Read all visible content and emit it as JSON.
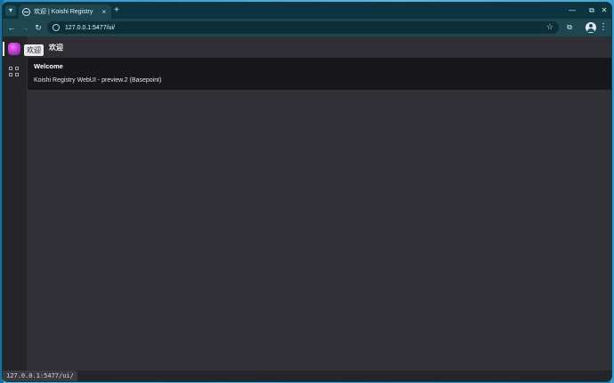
{
  "browser": {
    "tab": {
      "title": "欢迎 | Koishi Registry",
      "close": "×"
    },
    "new_tab": "+",
    "window_controls": {
      "minimize": "—",
      "maximize": "⧉",
      "close": "✕"
    },
    "nav": {
      "back": "←",
      "forward": "→",
      "reload": "↻"
    },
    "address": {
      "url": "127.0.0.1:5477/ui/"
    },
    "toolbar_icons": [
      "bookmark-star-icon",
      "extensions-icon",
      "profile-icon",
      "menu-icon"
    ],
    "menu_glyph": "⋮",
    "extensions_glyph": "⧉",
    "star_glyph": "☆"
  },
  "app": {
    "activity_bar": {
      "tooltip": "欢迎",
      "items": [
        "koishi-logo",
        "market-icon"
      ]
    },
    "header": {
      "title": "欢迎"
    },
    "welcome": {
      "heading": "Welcome",
      "description": "Koishi Registry WebUI - preview.2 (Basepoint)"
    }
  },
  "status_bar": {
    "url": "127.0.0.1:5477/ui/"
  },
  "colors": {
    "brand_gradient": "#c23fd1",
    "browser_frame": "#0b3440",
    "toolbar": "#1d4650",
    "app_bg": "#313036",
    "card_bg": "#18171b"
  }
}
